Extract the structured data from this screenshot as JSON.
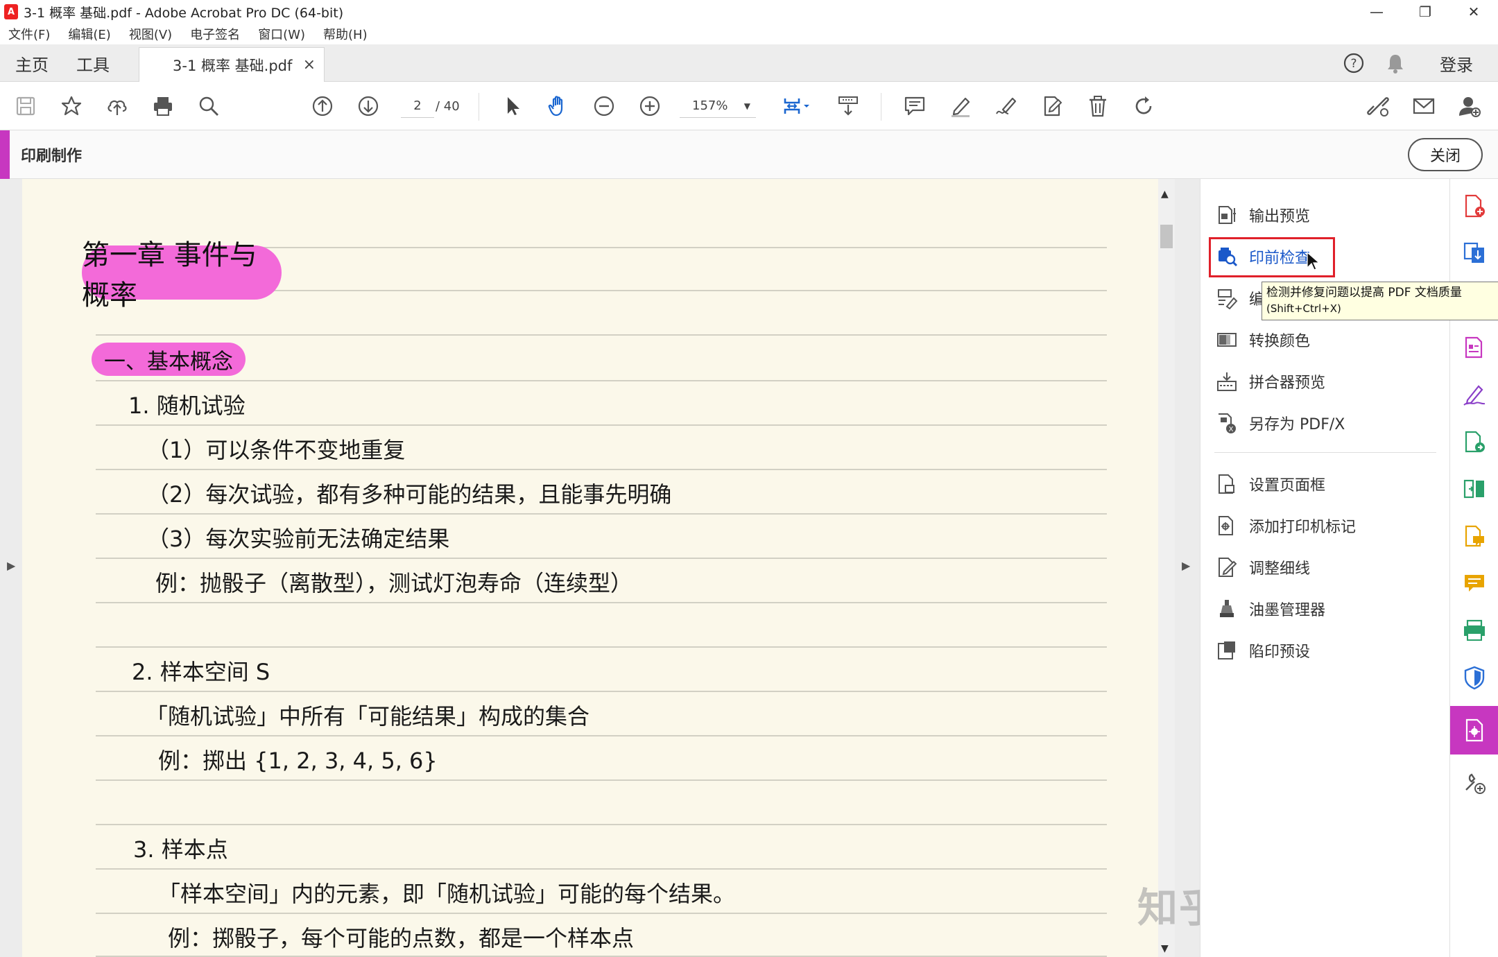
{
  "window": {
    "title": "3-1 概率 基础.pdf - Adobe Acrobat Pro DC (64-bit)",
    "minimize": "—",
    "restore": "❐",
    "close": "✕"
  },
  "menu": [
    "文件(F)",
    "编辑(E)",
    "视图(V)",
    "电子签名",
    "窗口(W)",
    "帮助(H)"
  ],
  "tabs": {
    "home": "主页",
    "tools": "工具",
    "document": "3-1 概率 基础.pdf",
    "close_glyph": "×",
    "login": "登录"
  },
  "toolbar": {
    "page_current": "2",
    "page_total": "/ 40",
    "zoom": "157%",
    "zoom_dd": "▼"
  },
  "panel": {
    "title": "印刷制作",
    "close_label": "关闭"
  },
  "document": {
    "chapter": "第一章 事件与概率",
    "section": "一、基本概念",
    "lines": [
      "1. 随机试验",
      "（1）可以条件不变地重复",
      "（2）每次试验，都有多种可能的结果，且能事先明确",
      "（3）每次实验前无法确定结果",
      "例：抛骰子（离散型），测试灯泡寿命（连续型）",
      "2. 样本空间 S",
      "「随机试验」中所有「可能结果」构成的集合",
      "例：掷出 {1, 2, 3, 4, 5, 6}",
      "3. 样本点",
      "「样本空间」内的元素，即「随机试验」可能的每个结果。",
      "例：掷骰子，每个可能的点数，都是一个样本点"
    ],
    "watermark": "知乎 @淳帅二代"
  },
  "tools_panel": {
    "items": [
      {
        "label": "输出预览",
        "icon": "output-preview-icon"
      },
      {
        "label": "印前检查",
        "icon": "preflight-icon"
      },
      {
        "label": "编",
        "icon": "edit-object-icon"
      },
      {
        "label": "转换颜色",
        "icon": "convert-colors-icon"
      },
      {
        "label": "拼合器预览",
        "icon": "flattener-preview-icon"
      },
      {
        "label": "另存为 PDF/X",
        "icon": "save-pdfx-icon"
      },
      {
        "label": "设置页面框",
        "icon": "set-page-boxes-icon"
      },
      {
        "label": "添加打印机标记",
        "icon": "printer-marks-icon"
      },
      {
        "label": "调整细线",
        "icon": "fix-hairlines-icon"
      },
      {
        "label": "油墨管理器",
        "icon": "ink-manager-icon"
      },
      {
        "label": "陷印预设",
        "icon": "trap-presets-icon"
      }
    ],
    "tooltip_line1": "检测并修复问题以提高 PDF 文档质量",
    "tooltip_line2": "(Shift+Ctrl+X)"
  },
  "scroll": {
    "up": "▲",
    "down": "▼"
  },
  "colors": {
    "accent": "#c737c0",
    "pill": "#f36ad9",
    "page_bg": "#fbf8ea",
    "active_text": "#1a58c9",
    "highlight_border": "#e0202a"
  }
}
